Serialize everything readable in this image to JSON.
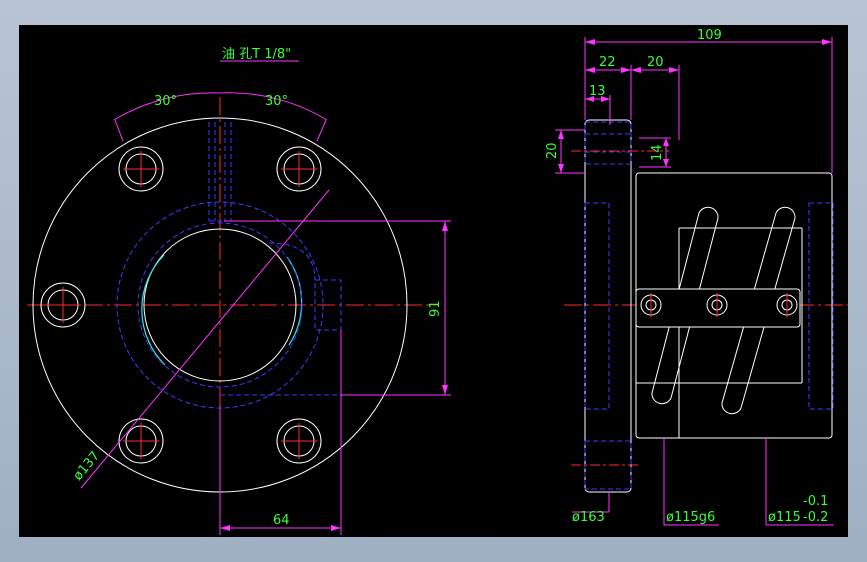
{
  "colors": {
    "background": "#000000",
    "outline": "#ffffff",
    "hidden": "#3b3bff",
    "center": "#ff2a2a",
    "dimension": "#ff33ff",
    "text": "#39ff39",
    "cyan": "#34e6e6"
  },
  "front_view": {
    "oil_hole_label": "油 孔T 1/8\"",
    "angle_left": "30°",
    "angle_right": "30°",
    "dim_91": "91",
    "dim_64": "64",
    "dia_137": "ø137"
  },
  "side_view": {
    "dim_109": "109",
    "dim_22": "22",
    "dim_20_top": "20",
    "dim_13": "13",
    "dim_20_left": "20",
    "dim_14": "14",
    "dia_163": "ø163",
    "dia_115g6": "ø115g6",
    "dia_115": "ø115",
    "tol_upper": "-0.1",
    "tol_lower": "-0.2"
  }
}
